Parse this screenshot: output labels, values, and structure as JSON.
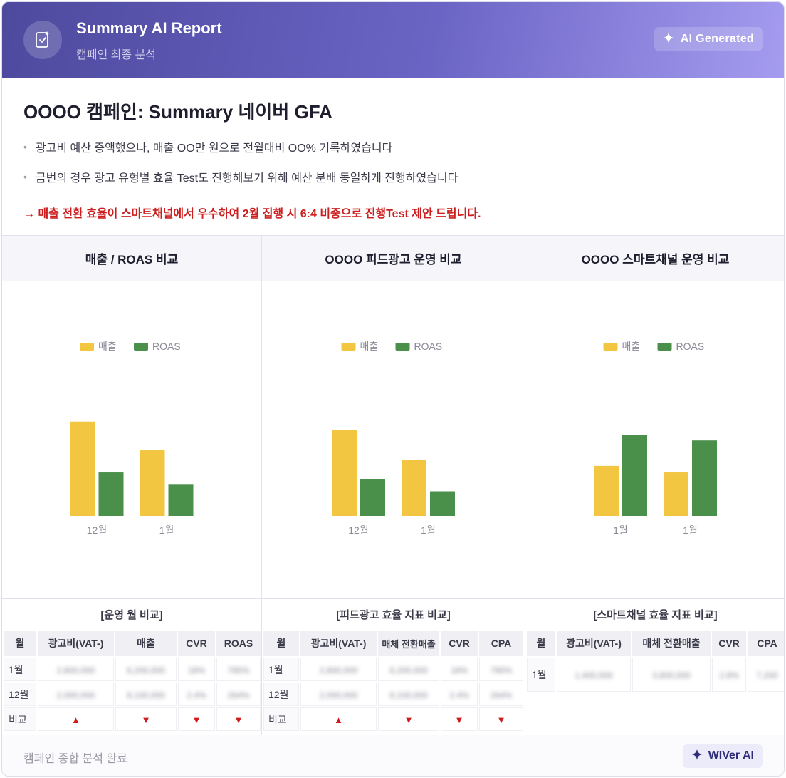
{
  "header": {
    "title": "Summary AI Report",
    "subtitle": "캠페인 최종 분석",
    "badge": "AI Generated",
    "icon": "clipboard-check-icon",
    "badge_icon": "sparkle-icon"
  },
  "summary": {
    "title": "OOOO 캠페인: Summary 네이버 GFA",
    "bullets": [
      "광고비 예산 증액했으나, 매출 OO만 원으로 전월대비 OO% 기록하였습니다",
      "금번의 경우 광고 유형별 효율 Test도 진행해보기 위해 예산 분배 동일하게 진행하였습니다"
    ],
    "proposal": "→ 매출 전환 효율이 스마트채널에서 우수하여 2월 집행 시 6:4 비중으로 진행Test 제안 드립니다."
  },
  "colors": {
    "sales": "#f2c641",
    "roas": "#4a8f4a",
    "down_arrow": "#d11a1a"
  },
  "columns": [
    {
      "heading": "매출 / ROAS 비교",
      "table_title": "[운영 월 비교]",
      "headers": [
        "월",
        "광고비(VAT-)",
        "매출",
        "CVR",
        "ROAS"
      ],
      "rows": [
        [
          "1월",
          "2,800,000",
          "6,200,000",
          "18%",
          "785%"
        ],
        [
          "12월",
          "2,000,000",
          "8,100,000",
          "2.4%",
          "264%"
        ],
        [
          "비교",
          "▲",
          "▼",
          "▼",
          "▼"
        ]
      ]
    },
    {
      "heading": "OOOO 피드광고 운영 비교",
      "table_title": "[피드광고 효율 지표 비교]",
      "headers": [
        "월",
        "광고비(VAT-)",
        "매체 전환매출",
        "CVR",
        "CPA"
      ],
      "rows": [
        [
          "1월",
          "2,800,000",
          "6,200,000",
          "18%",
          "785%"
        ],
        [
          "12월",
          "2,000,000",
          "8,100,000",
          "2.4%",
          "264%"
        ],
        [
          "비교",
          "▲",
          "▼",
          "▼",
          "▼"
        ]
      ]
    },
    {
      "heading": "OOOO 스마트채널 운영 비교",
      "table_title": "[스마트채널 효율 지표 비교]",
      "headers": [
        "월",
        "광고비(VAT-)",
        "매체 전환매출",
        "CVR",
        "CPA"
      ],
      "rows": [
        [
          "1월",
          "1,400,000",
          "3,800,000",
          "2.8%",
          "7,200"
        ]
      ]
    }
  ],
  "chart_data": [
    {
      "type": "bar",
      "categories": [
        "12월",
        "1월"
      ],
      "series": [
        {
          "name": "매출",
          "values": [
            115,
            80
          ]
        },
        {
          "name": "ROAS",
          "values": [
            53,
            38
          ]
        }
      ],
      "ylim": [
        0,
        200
      ],
      "legend": "top-center",
      "grid": false
    },
    {
      "type": "bar",
      "categories": [
        "12월",
        "1월"
      ],
      "series": [
        {
          "name": "매출",
          "values": [
            105,
            68
          ]
        },
        {
          "name": "ROAS",
          "values": [
            45,
            30
          ]
        }
      ],
      "ylim": [
        0,
        200
      ],
      "legend": "top-center",
      "grid": false
    },
    {
      "type": "bar",
      "categories": [
        "1월",
        "1월"
      ],
      "series": [
        {
          "name": "매출",
          "values": [
            61,
            53
          ]
        },
        {
          "name": "ROAS",
          "values": [
            99,
            92
          ]
        }
      ],
      "ylim": [
        0,
        200
      ],
      "legend": "top-center",
      "grid": false
    }
  ],
  "footer": {
    "status": "캠페인 종합 분석 완료",
    "badge": "WIVer AI",
    "badge_icon": "sparkle-icon"
  }
}
